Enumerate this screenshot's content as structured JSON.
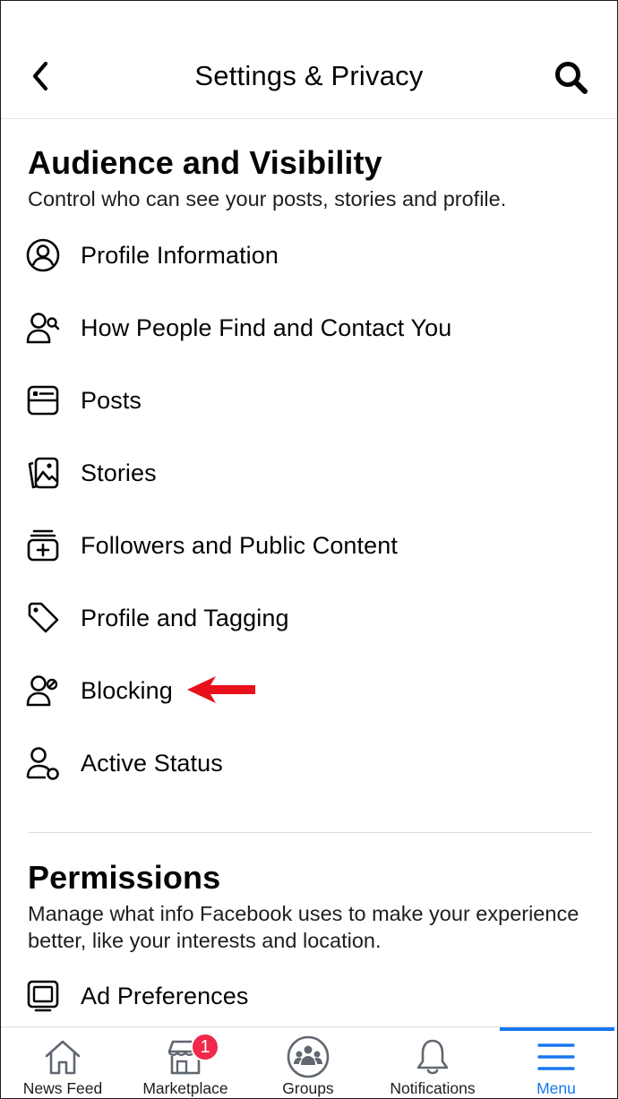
{
  "header": {
    "title": "Settings & Privacy",
    "back_icon": "chevron-left-icon",
    "search_icon": "search-icon"
  },
  "audience": {
    "title": "Audience and Visibility",
    "description": "Control who can see your posts, stories and profile.",
    "items": [
      {
        "label": "Profile Information",
        "icon": "user-circle-icon"
      },
      {
        "label": "How People Find and Contact You",
        "icon": "person-search-icon"
      },
      {
        "label": "Posts",
        "icon": "posts-icon"
      },
      {
        "label": "Stories",
        "icon": "stories-icon"
      },
      {
        "label": "Followers and Public Content",
        "icon": "followers-add-icon"
      },
      {
        "label": "Profile and Tagging",
        "icon": "tag-icon"
      },
      {
        "label": "Blocking",
        "icon": "person-block-icon"
      },
      {
        "label": "Active Status",
        "icon": "person-status-icon"
      }
    ]
  },
  "permissions": {
    "title": "Permissions",
    "description": "Manage what info Facebook uses to make your experience better, like your interests and location.",
    "items": [
      {
        "label": "Ad Preferences",
        "icon": "monitor-icon"
      }
    ]
  },
  "annotation": {
    "arrow_color": "#e8101a",
    "points_to": "Blocking"
  },
  "tabbar": {
    "tabs": [
      {
        "label": "News Feed",
        "icon": "home-icon"
      },
      {
        "label": "Marketplace",
        "icon": "shop-icon"
      },
      {
        "label": "Groups",
        "icon": "groups-icon"
      },
      {
        "label": "Notifications",
        "icon": "bell-icon"
      },
      {
        "label": "Menu",
        "icon": "hamburger-icon"
      }
    ],
    "marketplace_badge": "1",
    "active_tab": "Menu",
    "accent": "#1877f2",
    "badge_color": "#f02849"
  }
}
